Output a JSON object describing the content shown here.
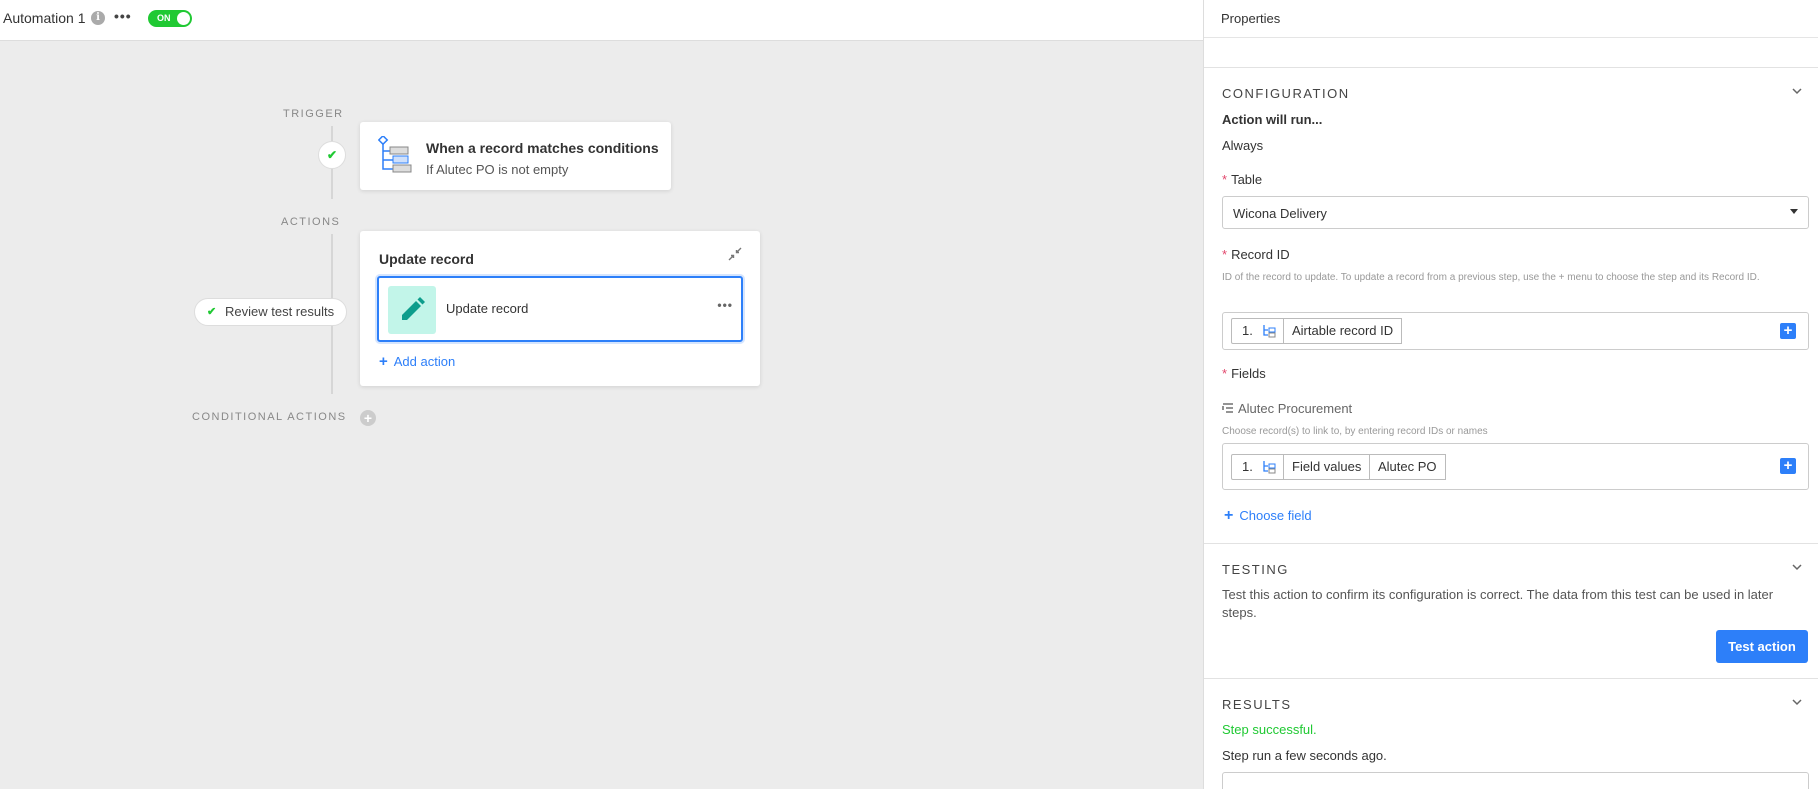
{
  "topbar": {
    "title": "Automation 1",
    "info_icon": "info-icon",
    "more_icon": "more-icon",
    "toggle_label": "ON",
    "toggle_color": "#20c933"
  },
  "canvas": {
    "trigger_label": "TRIGGER",
    "actions_label": "ACTIONS",
    "conditional_label": "CONDITIONAL ACTIONS",
    "trigger_card": {
      "title": "When a record matches conditions",
      "subtitle": "If Alutec PO is not empty"
    },
    "action_card": {
      "header": "Update record",
      "step_label": "Update record",
      "add_action": "Add action"
    },
    "review_pill": "Review test results"
  },
  "panel": {
    "header": "Properties",
    "configuration": {
      "title": "CONFIGURATION",
      "action_will_run": "Action will run...",
      "run_value": "Always",
      "table_label": "Table",
      "table_value": "Wicona Delivery",
      "record_id_label": "Record ID",
      "record_id_help": "ID of the record to update. To update a record from a previous step, use the + menu to choose the step and its Record ID.",
      "record_id_token": {
        "step": "1.",
        "value": "Airtable record ID"
      },
      "fields_label": "Fields",
      "field_name": "Alutec Procurement",
      "field_help": "Choose record(s) to link to, by entering record IDs or names",
      "field_tokens": {
        "step": "1.",
        "values": [
          "Field values",
          "Alutec PO"
        ]
      },
      "choose_field": "Choose field"
    },
    "testing": {
      "title": "TESTING",
      "description": "Test this action to confirm its configuration is correct. The data from this test can be used in later steps.",
      "button": "Test action"
    },
    "results": {
      "title": "RESULTS",
      "status": "Step successful.",
      "time": "Step run a few seconds ago."
    }
  },
  "colors": {
    "accent": "#2d7ff9",
    "success": "#20c933",
    "required": "#e2476c"
  }
}
